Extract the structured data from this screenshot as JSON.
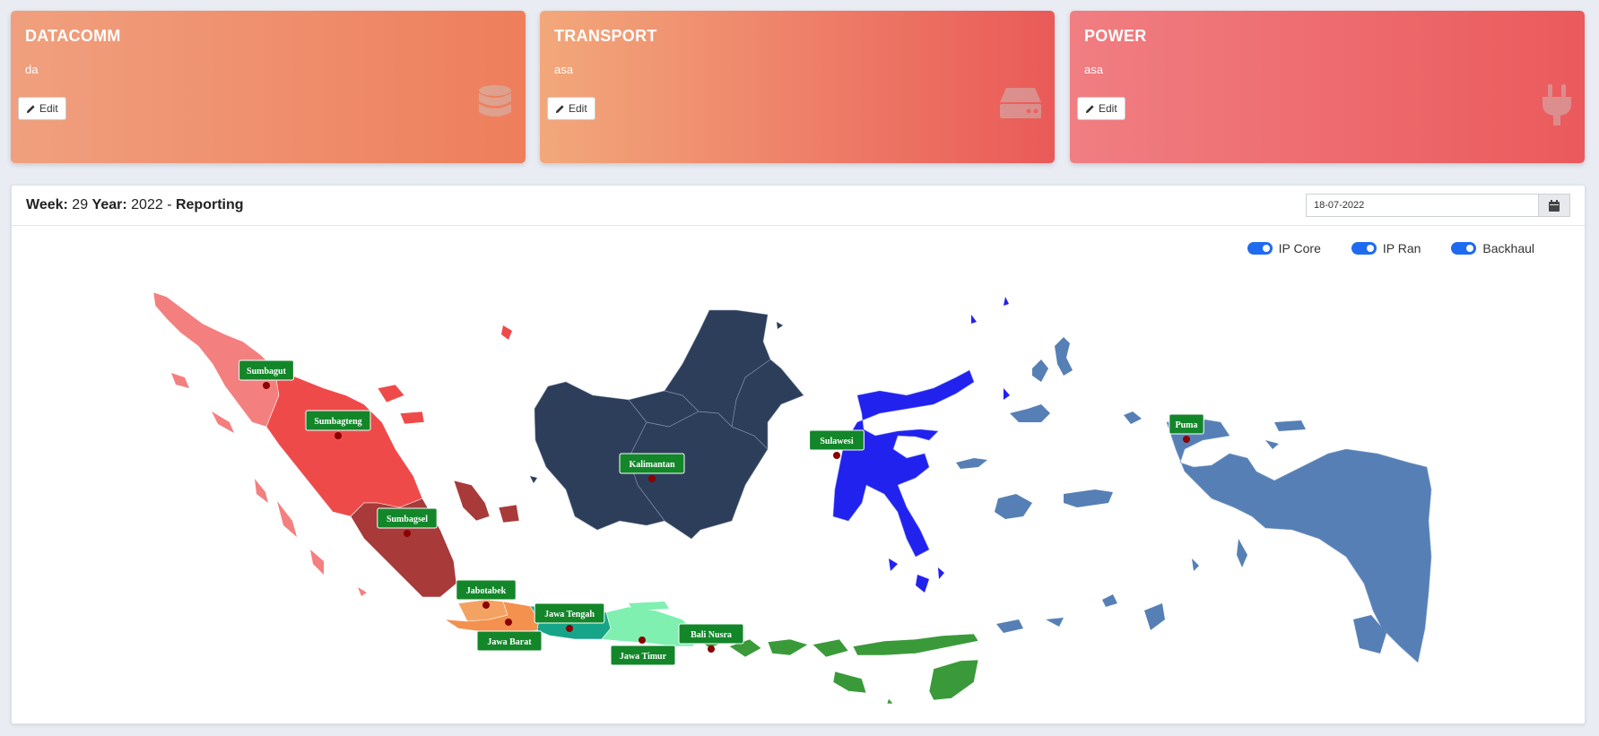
{
  "cards": [
    {
      "title": "DATACOMM",
      "desc": "da",
      "edit_label": "Edit",
      "icon": "database-icon"
    },
    {
      "title": "TRANSPORT",
      "desc": "asa",
      "edit_label": "Edit",
      "icon": "hdd-icon"
    },
    {
      "title": "POWER",
      "desc": "asa",
      "edit_label": "Edit",
      "icon": "plug-icon"
    }
  ],
  "report": {
    "week_label": "Week:",
    "week": "29",
    "year_label": "Year:",
    "year": "2022",
    "separator": "-",
    "title": "Reporting",
    "date_value": "18-07-2022"
  },
  "toggles": [
    {
      "label": "IP Core",
      "on": true
    },
    {
      "label": "IP Ran",
      "on": true
    },
    {
      "label": "Backhaul",
      "on": true
    }
  ],
  "regions": [
    {
      "name": "Sumbagut",
      "color": "#f47f7f"
    },
    {
      "name": "Sumbagteng",
      "color": "#ef4a4a"
    },
    {
      "name": "Sumbagsel",
      "color": "#a83a3a"
    },
    {
      "name": "Jabotabek",
      "color": "#f4a262"
    },
    {
      "name": "Jawa Barat",
      "color": "#f4914f"
    },
    {
      "name": "Jawa Tengah",
      "color": "#17a589"
    },
    {
      "name": "Jawa Timur",
      "color": "#7ff0b0"
    },
    {
      "name": "Bali Nusra",
      "color": "#3a9a3a"
    },
    {
      "name": "Kalimantan",
      "color": "#2c3e5a"
    },
    {
      "name": "Sulawesi",
      "color": "#2222ee"
    },
    {
      "name": "Puma",
      "color": "#5680b5"
    }
  ]
}
